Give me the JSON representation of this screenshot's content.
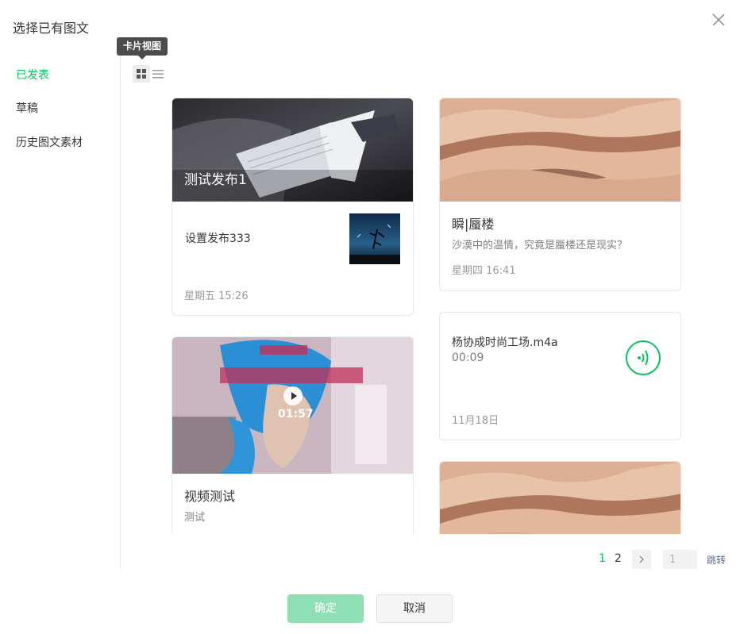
{
  "dialog": {
    "title": "选择已有图文"
  },
  "sidebar": {
    "items": [
      {
        "label": "已发表",
        "active": true
      },
      {
        "label": "草稿"
      },
      {
        "label": "历史图文素材"
      }
    ]
  },
  "toolbar": {
    "tooltip": "卡片视图"
  },
  "cards": [
    {
      "type": "article",
      "cover_title": "测试发布1",
      "sub_title": "设置发布333",
      "time": "星期五 15:26"
    },
    {
      "type": "article",
      "title": "瞬|蜃楼",
      "desc": "沙漠中的温情，究竟是蜃楼还是现实？",
      "time": "星期四 16:41"
    },
    {
      "type": "video",
      "duration": "01:57",
      "title": "视频测试",
      "desc": "测试"
    },
    {
      "type": "audio",
      "title": "杨协成时尚工场.m4a",
      "duration": "00:09",
      "time": "11月18日"
    },
    {
      "type": "article"
    }
  ],
  "pagination": {
    "pages": [
      "1",
      "2"
    ],
    "current": "1",
    "input_value": "1",
    "jump_label": "跳转"
  },
  "footer": {
    "ok_label": "确定",
    "cancel_label": "取消"
  },
  "colors": {
    "accent": "#07c160",
    "ok_disabled": "#8fdfb4",
    "link": "#576b95"
  }
}
